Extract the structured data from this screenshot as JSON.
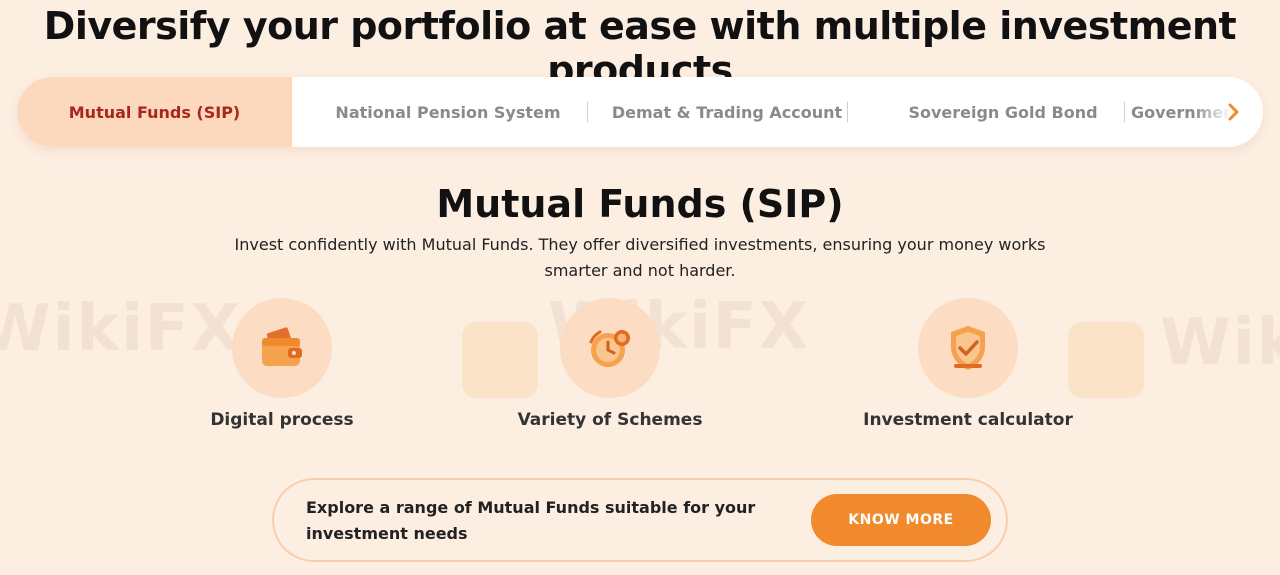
{
  "headline": "Diversify your portfolio at ease with multiple investment products",
  "tabs": [
    {
      "label": "Mutual Funds (SIP)",
      "active": true
    },
    {
      "label": "National Pension System",
      "active": false
    },
    {
      "label": "Demat & Trading Account",
      "active": false
    },
    {
      "label": "Sovereign Gold Bond",
      "active": false
    },
    {
      "label": "Government",
      "active": false
    }
  ],
  "section": {
    "title": "Mutual Funds (SIP)",
    "description": "Invest confidently with Mutual Funds. They offer diversified investments, ensuring your money works smarter and not harder."
  },
  "features": [
    {
      "label": "Digital process",
      "icon": "wallet-icon"
    },
    {
      "label": "Variety of Schemes",
      "icon": "clock-coin-icon"
    },
    {
      "label": "Investment calculator",
      "icon": "shield-check-icon"
    }
  ],
  "cta": {
    "text": "Explore a range of Mutual Funds suitable for your investment needs",
    "button_label": "KNOW MORE"
  },
  "watermark": {
    "text": "WikiFX"
  },
  "colors": {
    "background": "#fdeee2",
    "accent": "#f08a2c",
    "active_tab_bg": "#fcd9bc",
    "active_tab_text": "#a8271e"
  }
}
